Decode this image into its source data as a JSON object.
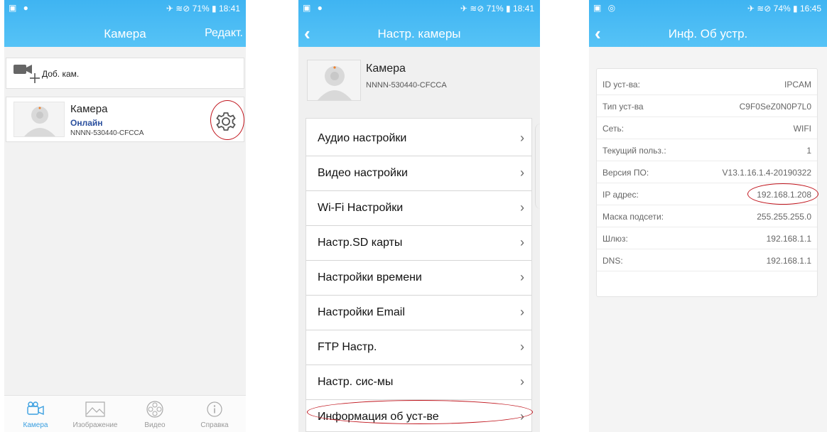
{
  "screens": {
    "camera_list": {
      "status_left": "▣ ●",
      "status_right": "✈ ≋⊘ 71% ▮ 18:41",
      "title": "Камера",
      "edit_label": "Редакт.",
      "add_camera_label": "Доб. кам.",
      "camera": {
        "name": "Камера",
        "status": "Онлайн",
        "id": "NNNN-530440-CFCCA"
      },
      "nav": [
        {
          "label": "Камера",
          "icon": "camera-icon",
          "active": true
        },
        {
          "label": "Изображение",
          "icon": "image-icon",
          "active": false
        },
        {
          "label": "Видео",
          "icon": "film-reel-icon",
          "active": false
        },
        {
          "label": "Справка",
          "icon": "info-icon",
          "active": false
        }
      ]
    },
    "camera_settings": {
      "status_left": "▣ ●",
      "status_right": "✈ ≋⊘ 71% ▮ 18:41",
      "title": "Настр. камеры",
      "device": {
        "name": "Камера",
        "id": "NNNN-530440-CFCCA"
      },
      "menu": [
        "Аудио настройки",
        "Видео настройки",
        "Wi-Fi Настройки",
        "Настр.SD карты",
        "Настройки времени",
        "Настройки Email",
        "FTP Настр.",
        "Настр. сис-мы",
        "Информация об уст-ве"
      ]
    },
    "device_info": {
      "status_left": "▣ ◎",
      "status_right": "✈ ≋⊘ 74% ▮ 16:45",
      "title": "Инф. Об устр.",
      "rows": [
        {
          "key": "ID уст-ва:",
          "value": "IPCAM"
        },
        {
          "key": "Тип уст-ва",
          "value": "C9F0SeZ0N0P7L0"
        },
        {
          "key": "Сеть:",
          "value": "WIFI"
        },
        {
          "key": "Текущий польз.:",
          "value": "1"
        },
        {
          "key": "Версия ПО:",
          "value": "V13.1.16.1.4-20190322"
        },
        {
          "key": "IP адрес:",
          "value": "192.168.1.208"
        },
        {
          "key": "Маска подсети:",
          "value": "255.255.255.0"
        },
        {
          "key": "Шлюз:",
          "value": "192.168.1.1"
        },
        {
          "key": "DNS:",
          "value": "192.168.1.1"
        }
      ]
    }
  },
  "colors": {
    "header": "#3fb4f2",
    "annotation": "#c0141c",
    "online": "#2a4f9e"
  }
}
